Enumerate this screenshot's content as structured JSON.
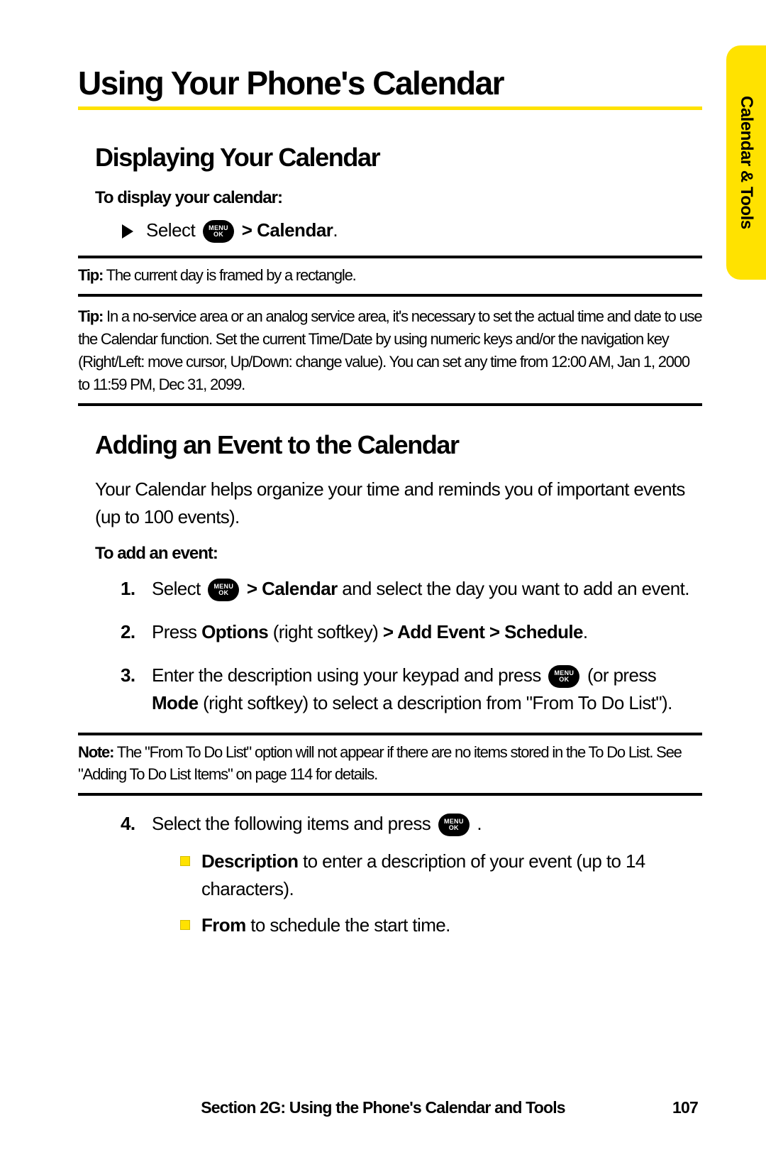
{
  "sidetab": "Calendar & Tools",
  "title": "Using Your Phone's Calendar",
  "sec1": {
    "heading": "Displaying Your Calendar",
    "lead": "To display your calendar:",
    "step_select": "Select",
    "step_calendar": " > Calendar",
    "step_period": "."
  },
  "menu_ok": {
    "line1": "MENU",
    "line2": "OK"
  },
  "tip1_label": "Tip:",
  "tip1_text": " The current day is framed by a rectangle.",
  "tip2_label": "Tip:",
  "tip2_text": " In a no-service area or an analog service area, it's necessary to set the actual time and date to use the Calendar function. Set the current Time/Date by using numeric keys and/or the navigation key (Right/Left: move cursor, Up/Down: change value). You can set any time from 12:00 AM, Jan 1, 2000 to 11:59 PM, Dec 31, 2099.",
  "sec2": {
    "heading": "Adding an Event to the Calendar",
    "intro": "Your Calendar helps organize your time and reminds you of important events (up to 100 events).",
    "lead": "To add an event:"
  },
  "steps": {
    "s1_a": "Select ",
    "s1_bold": " > Calendar",
    "s1_b": " and select the day you want to add an event.",
    "s2_a": "Press ",
    "s2_b1": "Options",
    "s2_mid": " (right softkey) ",
    "s2_b2": "> Add Event > Schedule",
    "s2_end": ".",
    "s3_a": "Enter the description using your keypad and press ",
    "s3_b": " (or press ",
    "s3_bold": "Mode",
    "s3_c": " (right softkey) to select a description from \"From To Do List\").",
    "s4_a": "Select the following items and press ",
    "s4_b": " ."
  },
  "note_label": "Note:",
  "note_text": " The \"From To Do List\" option will not appear if there are no items stored in the To Do List. See \"Adding To Do List Items\" on page 114 for details.",
  "sub": {
    "desc_b": "Description",
    "desc_t": " to enter a description of your event (up to 14 characters).",
    "from_b": "From",
    "from_t": " to schedule the start time."
  },
  "footer": {
    "section": "Section 2G: Using the Phone's Calendar and Tools",
    "page": "107"
  }
}
